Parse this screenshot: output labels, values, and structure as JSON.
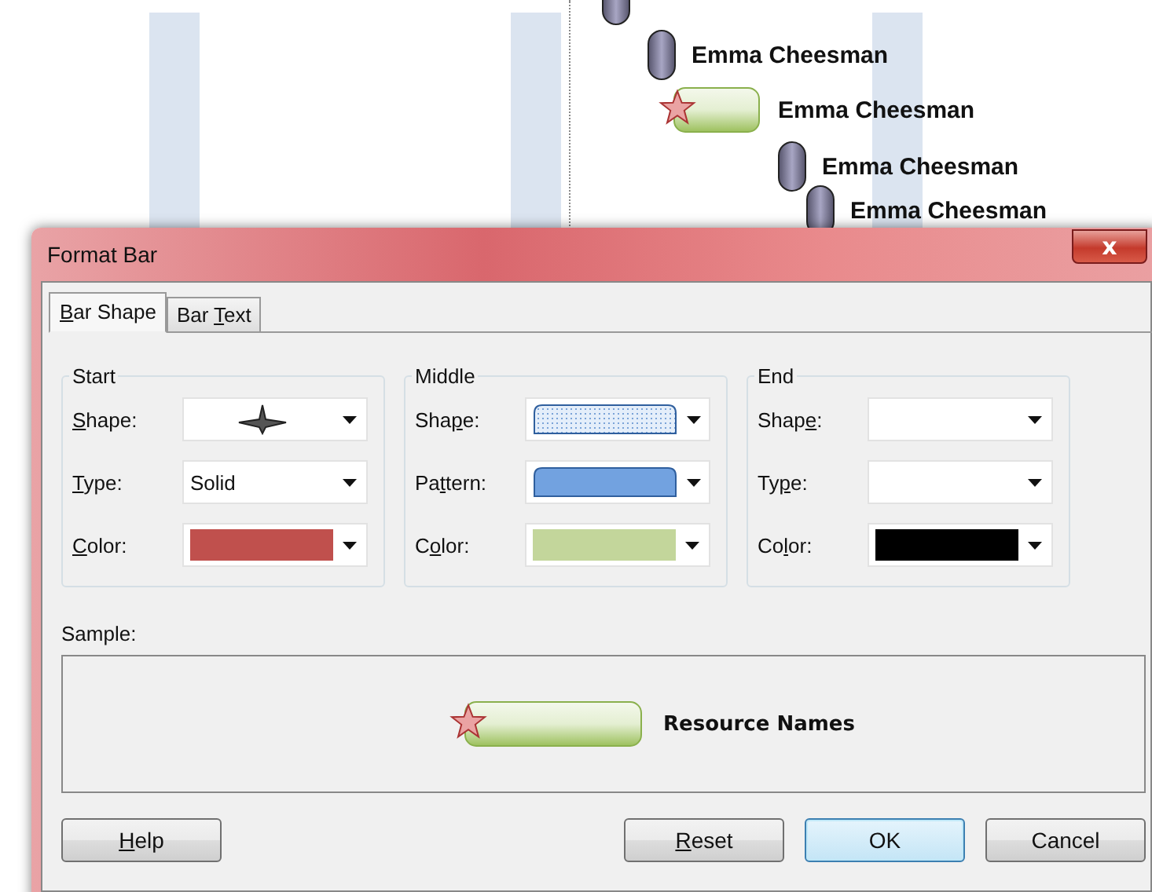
{
  "gantt": {
    "rows": [
      {
        "kind": "milestone",
        "name": "Emma Cheesman"
      },
      {
        "kind": "bar",
        "name": "Emma Cheesman"
      },
      {
        "kind": "milestone",
        "name": "Emma Cheesman"
      },
      {
        "kind": "milestone",
        "name": "Emma Cheesman"
      }
    ]
  },
  "dialog": {
    "title": "Format Bar",
    "close": "x",
    "tabs": [
      {
        "label": {
          "key": "B",
          "after": "ar Shape"
        },
        "selected": true
      },
      {
        "label": {
          "before": "Bar ",
          "key": "T",
          "after": "ext"
        },
        "selected": false
      }
    ],
    "groups": [
      {
        "title": "Start",
        "rows": [
          {
            "label": {
              "key": "S",
              "after": "hape:"
            },
            "combo": {
              "kind": "star"
            }
          },
          {
            "label": {
              "key": "T",
              "after": "ype:"
            },
            "combo": {
              "kind": "text",
              "value": "Solid"
            }
          },
          {
            "label": {
              "key": "C",
              "after": "olor:"
            },
            "combo": {
              "kind": "color",
              "color": "#c0504d"
            }
          }
        ]
      },
      {
        "title": "Middle",
        "rows": [
          {
            "label": {
              "before": "Sha",
              "key": "p",
              "after": "e:"
            },
            "combo": {
              "kind": "hatched"
            }
          },
          {
            "label": {
              "before": "Pa",
              "key": "t",
              "after": "tern:"
            },
            "combo": {
              "kind": "solid"
            }
          },
          {
            "label": {
              "before": "C",
              "key": "o",
              "after": "lor:"
            },
            "combo": {
              "kind": "color",
              "color": "#c3d69b"
            }
          }
        ]
      },
      {
        "title": "End",
        "rows": [
          {
            "label": {
              "before": "Shap",
              "key": "e",
              "after": ":"
            },
            "combo": {
              "kind": "empty"
            }
          },
          {
            "label": {
              "before": "Ty",
              "key": "p",
              "after": "e:"
            },
            "combo": {
              "kind": "empty"
            }
          },
          {
            "label": {
              "before": "Co",
              "key": "l",
              "after": "or:"
            },
            "combo": {
              "kind": "color",
              "color": "#000000"
            }
          }
        ]
      }
    ],
    "sample": {
      "label": "Sample:",
      "text": "Resource Names"
    },
    "buttons": [
      {
        "label": {
          "key": "H",
          "after": "elp"
        },
        "default": false
      },
      {
        "label": {
          "key": "R",
          "after": "eset"
        },
        "default": false
      },
      {
        "label": {
          "before": "OK"
        },
        "default": true
      },
      {
        "label": {
          "before": "Cancel"
        },
        "default": false
      }
    ]
  }
}
